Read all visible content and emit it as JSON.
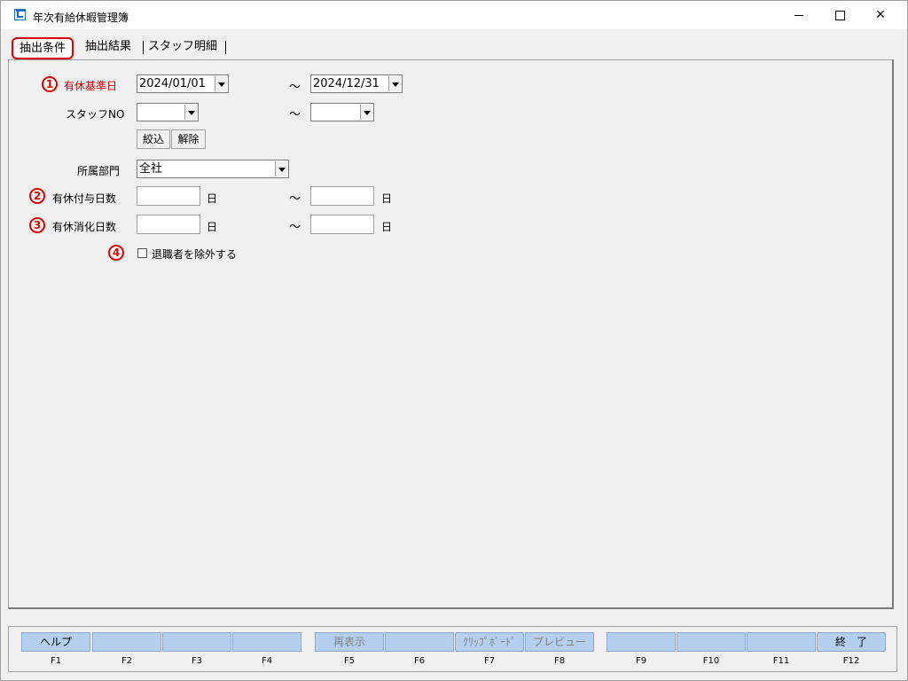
{
  "window": {
    "title": "年次有給休暇管理簿",
    "minimize_icon": "minimize-icon",
    "maximize_icon": "maximize-icon",
    "close_icon": "close-icon"
  },
  "tabs": [
    {
      "label": "抽出条件",
      "active": true
    },
    {
      "label": "抽出結果",
      "active": false
    },
    {
      "label": "スタッフ明細",
      "active": false
    }
  ],
  "annotations": {
    "n1": "1",
    "n2": "2",
    "n3": "3",
    "n4": "4",
    "color": "#e00000"
  },
  "form": {
    "base_date_label": "有休基準日",
    "base_date_from": "2024/01/01",
    "base_date_to": "2024/12/31",
    "tilde": "～",
    "staff_no_label": "スタッフNO",
    "staff_no_from": "",
    "staff_no_to": "",
    "filter_button": "絞込",
    "clear_button": "解除",
    "dept_label": "所属部門",
    "dept_value": "全社",
    "grant_days_label": "有休付与日数",
    "grant_days_from": "",
    "grant_days_to": "",
    "used_days_label": "有休消化日数",
    "used_days_from": "",
    "used_days_to": "",
    "day_unit": "日",
    "exclude_retired_label": "退職者を除外する",
    "exclude_retired_checked": false
  },
  "function_keys": [
    {
      "key": "F1",
      "label": "ヘルプ"
    },
    {
      "key": "F2",
      "label": ""
    },
    {
      "key": "F3",
      "label": ""
    },
    {
      "key": "F4",
      "label": ""
    },
    {
      "key": "F5",
      "label": "再表示"
    },
    {
      "key": "F6",
      "label": ""
    },
    {
      "key": "F7",
      "label": "ｸﾘｯﾌﾟﾎﾞｰﾄﾞ"
    },
    {
      "key": "F8",
      "label": "プレビュー"
    },
    {
      "key": "F9",
      "label": ""
    },
    {
      "key": "F10",
      "label": ""
    },
    {
      "key": "F11",
      "label": ""
    },
    {
      "key": "F12",
      "label": "終　了"
    }
  ]
}
